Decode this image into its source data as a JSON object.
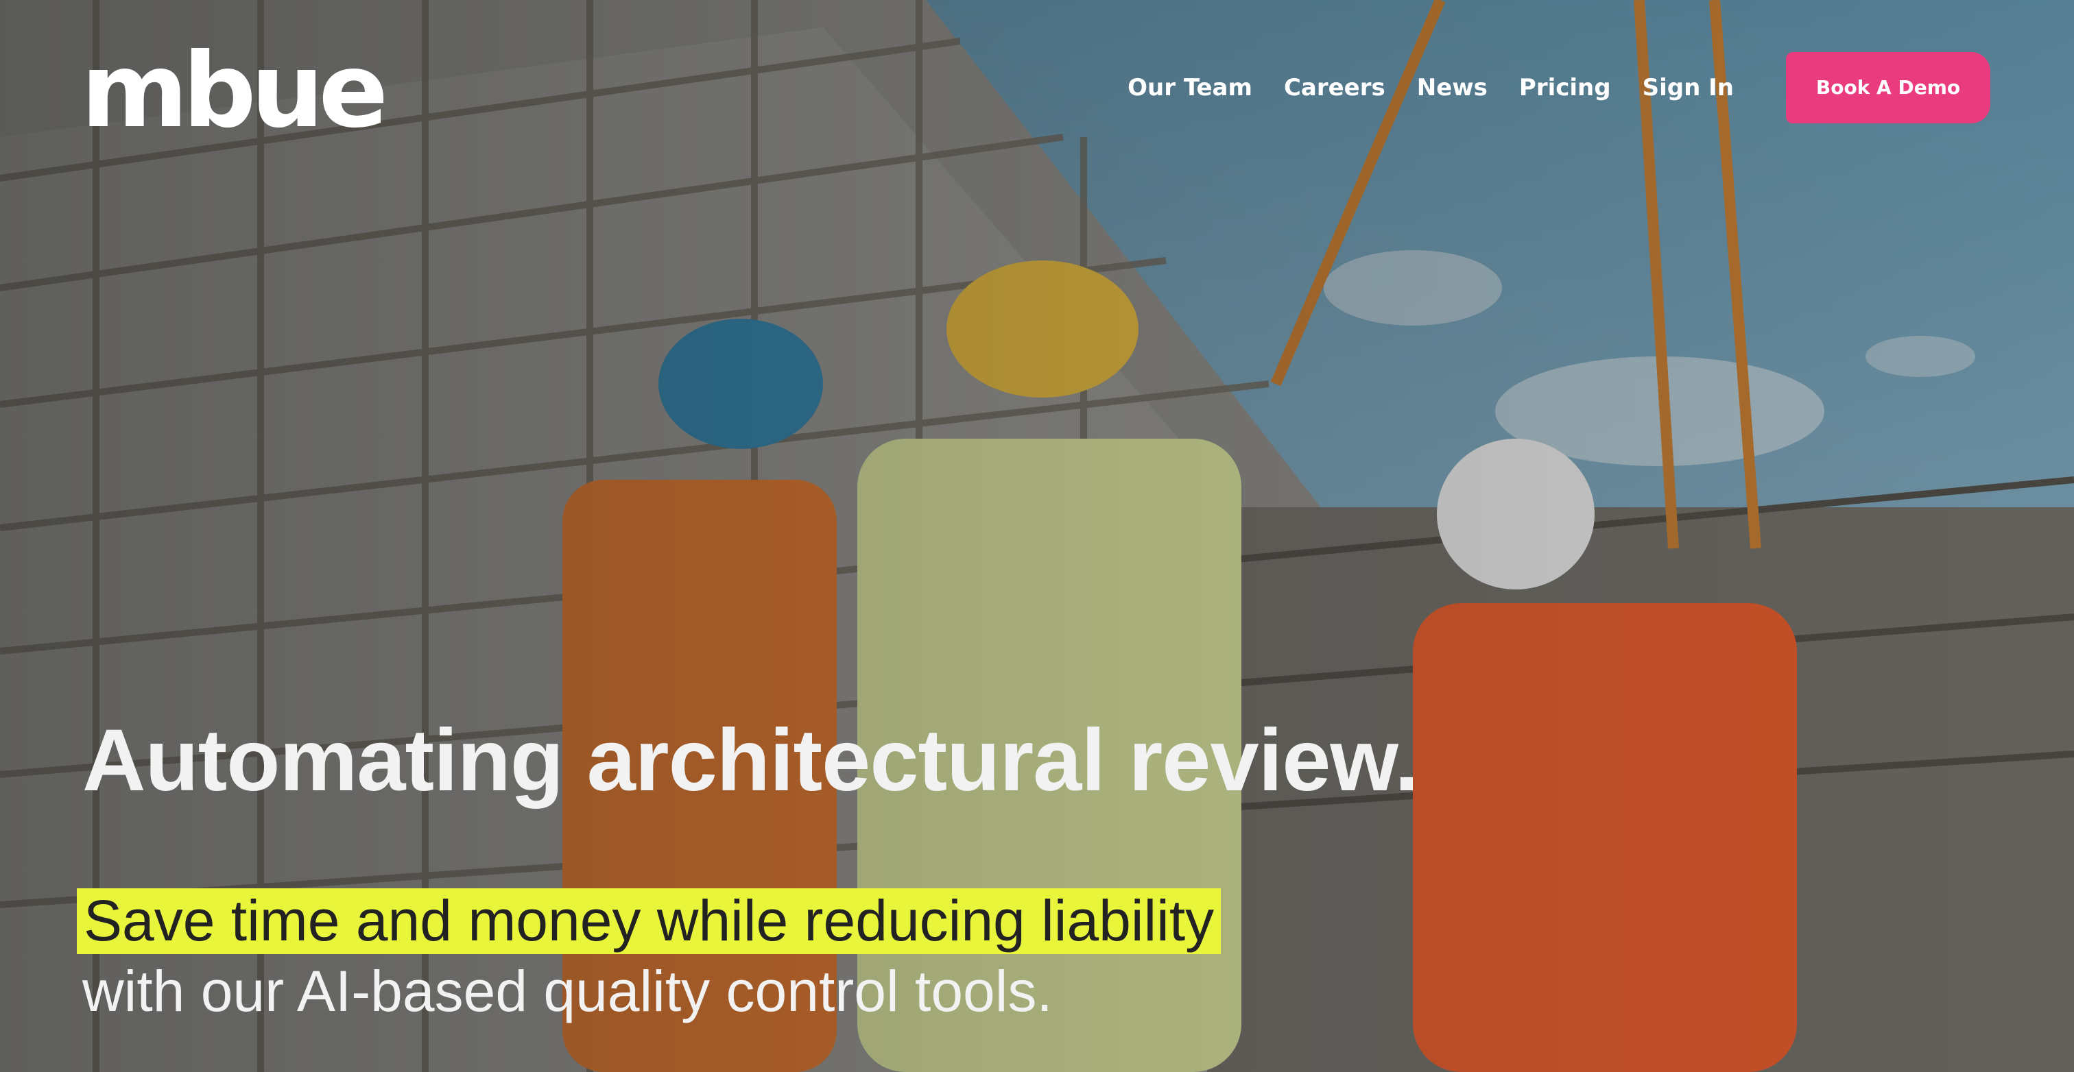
{
  "brand": {
    "logo_text": "mbue",
    "accent_color": "#ea3b7e",
    "highlight_color": "#e9f53a"
  },
  "nav": {
    "items": [
      {
        "label": "Our Team"
      },
      {
        "label": "Careers"
      },
      {
        "label": "News"
      },
      {
        "label": "Pricing"
      },
      {
        "label": "Sign In"
      }
    ],
    "cta_label": "Book A Demo"
  },
  "hero": {
    "headline": "Automating architectural review.",
    "subheadline_highlight": "Save time and money while reducing liability",
    "subheadline_rest": "with our AI-based quality control tools."
  }
}
